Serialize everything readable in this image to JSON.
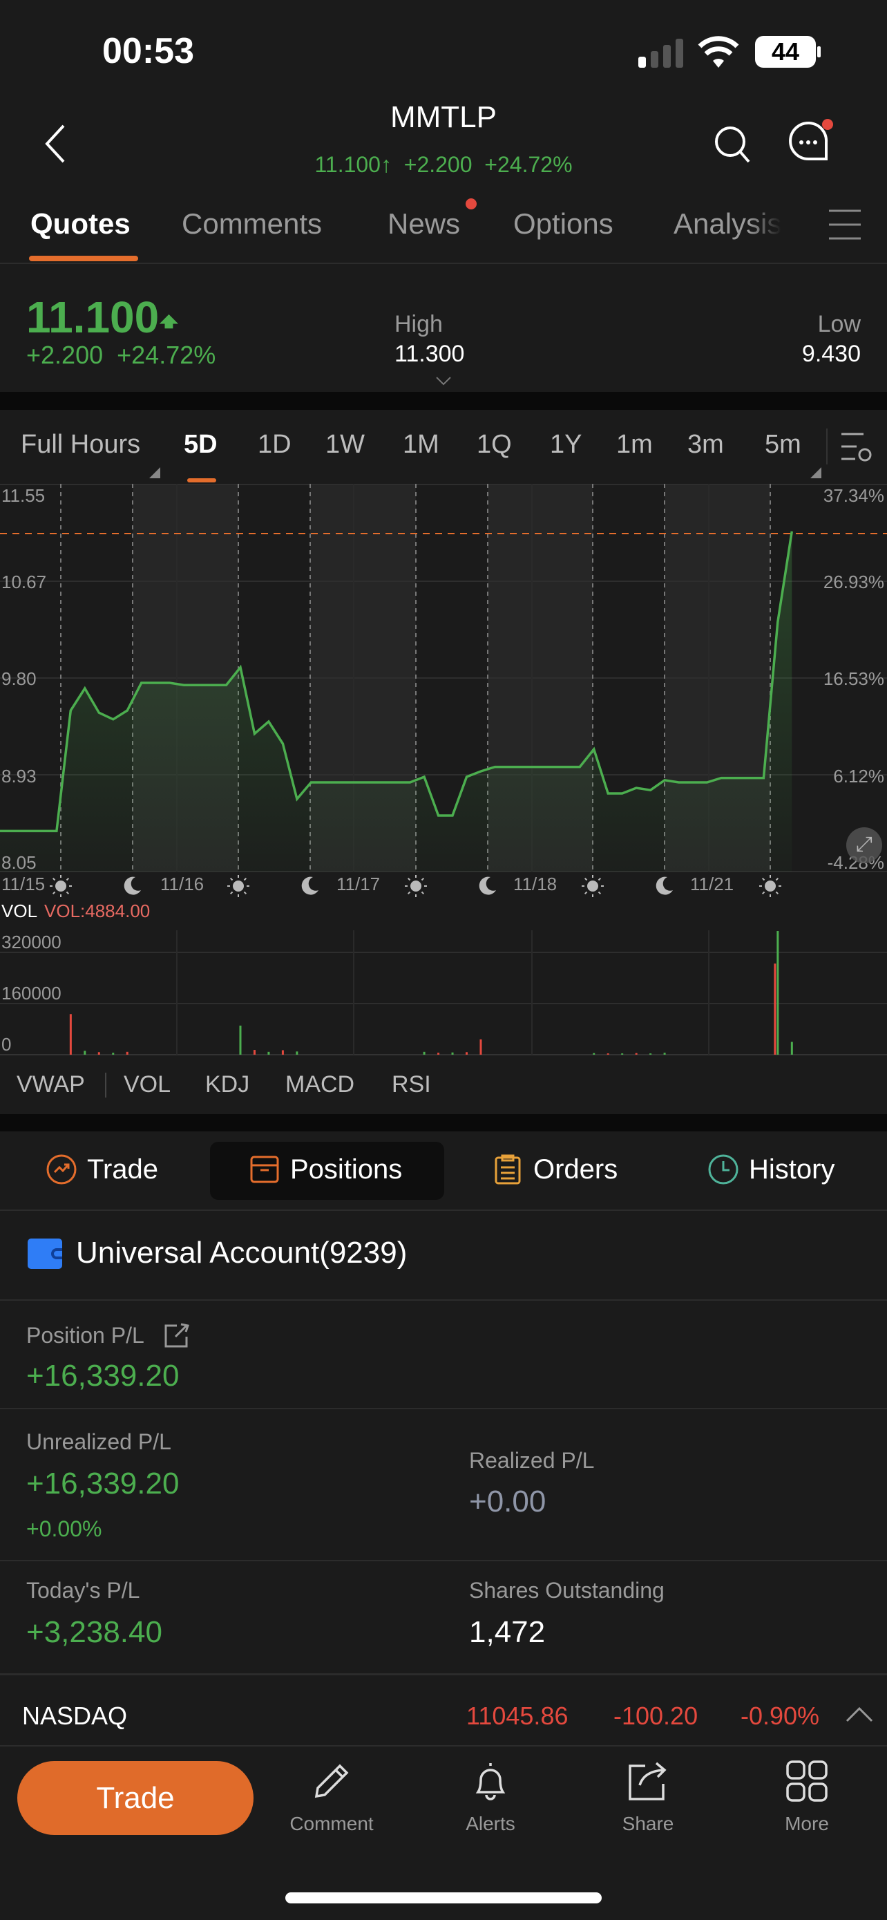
{
  "status_bar": {
    "time": "00:53",
    "battery": "44",
    "signal_bars_active": 1,
    "signal_bars_total": 4
  },
  "header": {
    "symbol": "MMTLP",
    "price": "11.100",
    "change": "+2.200",
    "change_pct": "+24.72%"
  },
  "tabs": [
    {
      "label": "Quotes",
      "active": true
    },
    {
      "label": "Comments"
    },
    {
      "label": "News",
      "badge": true
    },
    {
      "label": "Options"
    },
    {
      "label": "Analysis"
    }
  ],
  "quote": {
    "price": "11.100",
    "change": "+2.200",
    "change_pct": "+24.72%",
    "high_label": "High",
    "high": "11.300",
    "low_label": "Low",
    "low": "9.430"
  },
  "timeframes": {
    "session": "Full Hours",
    "items": [
      "5D",
      "1D",
      "1W",
      "1M",
      "1Q",
      "1Y",
      "1m",
      "3m",
      "5m"
    ],
    "active": "5D"
  },
  "chart_data": [
    {
      "type": "line",
      "price_ticks": [
        "11.55",
        "10.67",
        "9.80",
        "8.93",
        "8.05"
      ],
      "pct_ticks": [
        "37.34%",
        "26.93%",
        "16.53%",
        "6.12%",
        "-4.28%"
      ],
      "ylim": [
        8.05,
        11.55
      ],
      "current_price": 11.1,
      "date_labels": [
        "11/15",
        "11/16",
        "11/17",
        "11/18",
        "11/21"
      ],
      "session_markers": [
        "sun",
        "moon",
        "sun",
        "moon",
        "sun",
        "moon",
        "sun",
        "moon",
        "sun"
      ],
      "values": [
        8.41,
        8.41,
        8.41,
        8.41,
        8.41,
        9.5,
        9.7,
        9.48,
        9.42,
        9.5,
        9.75,
        9.75,
        9.75,
        9.73,
        9.73,
        9.73,
        9.73,
        9.89,
        9.29,
        9.4,
        9.2,
        8.7,
        8.85,
        8.85,
        8.85,
        8.85,
        8.85,
        8.85,
        8.85,
        8.85,
        8.9,
        8.55,
        8.55,
        8.9,
        8.95,
        8.99,
        8.99,
        8.99,
        8.99,
        8.99,
        8.99,
        8.99,
        9.15,
        8.75,
        8.75,
        8.8,
        8.78,
        8.87,
        8.85,
        8.85,
        8.85,
        8.89,
        8.89,
        8.89,
        8.89,
        10.3,
        11.12
      ],
      "line_color": "#4cae4f"
    },
    {
      "type": "bar",
      "label": "VOL",
      "readout": "VOL:4884.00",
      "ticks": [
        "320000",
        "160000",
        "0"
      ],
      "ylim": [
        0,
        320000
      ],
      "values": [
        0,
        0,
        0,
        0,
        0,
        127000,
        12000,
        8000,
        6000,
        9000,
        0,
        0,
        0,
        0,
        0,
        0,
        0,
        91000,
        15000,
        9000,
        14000,
        10000,
        0,
        0,
        0,
        0,
        0,
        0,
        0,
        0,
        9000,
        6000,
        7000,
        8000,
        48000,
        0,
        0,
        0,
        0,
        0,
        0,
        0,
        5000,
        4000,
        4000,
        5000,
        4000,
        6000,
        0,
        0,
        0,
        0,
        0,
        0,
        0,
        387000,
        40000
      ],
      "up": [
        1,
        1,
        1,
        1,
        1,
        0,
        1,
        0,
        1,
        0,
        1,
        1,
        1,
        1,
        1,
        1,
        1,
        1,
        0,
        1,
        0,
        1,
        1,
        1,
        1,
        1,
        1,
        1,
        1,
        1,
        1,
        0,
        1,
        0,
        0,
        1,
        1,
        1,
        1,
        1,
        1,
        1,
        1,
        0,
        1,
        0,
        1,
        1,
        1,
        1,
        1,
        1,
        1,
        1,
        1,
        1,
        1
      ],
      "extra_spike": 285000
    }
  ],
  "indicators": {
    "items": [
      "VWAP",
      "VOL",
      "KDJ",
      "MACD",
      "RSI"
    ],
    "active": "VOL"
  },
  "trade_tabs": [
    {
      "label": "Trade",
      "icon": "trade-icon"
    },
    {
      "label": "Positions",
      "icon": "positions-icon",
      "active": true
    },
    {
      "label": "Orders",
      "icon": "orders-icon"
    },
    {
      "label": "History",
      "icon": "history-icon"
    }
  ],
  "account": {
    "name": "Universal Account(9239)"
  },
  "positions": {
    "position_pl_label": "Position P/L",
    "position_pl": "+16,339.20",
    "unrealized_label": "Unrealized P/L",
    "unrealized": "+16,339.20",
    "unrealized_pct": "+0.00%",
    "realized_label": "Realized P/L",
    "realized": "+0.00",
    "today_label": "Today's P/L",
    "today": "+3,238.40",
    "shares_label": "Shares Outstanding",
    "shares": "1,472"
  },
  "index_ticker": {
    "name": "NASDAQ",
    "value": "11045.86",
    "change": "-100.20",
    "change_pct": "-0.90%"
  },
  "bottom_bar": {
    "trade": "Trade",
    "items": [
      "Comment",
      "Alerts",
      "Share",
      "More"
    ]
  },
  "colors": {
    "up": "#4cae4f",
    "down": "#e4493e",
    "accent": "#e46d2c",
    "bg": "#1b1b1b"
  }
}
